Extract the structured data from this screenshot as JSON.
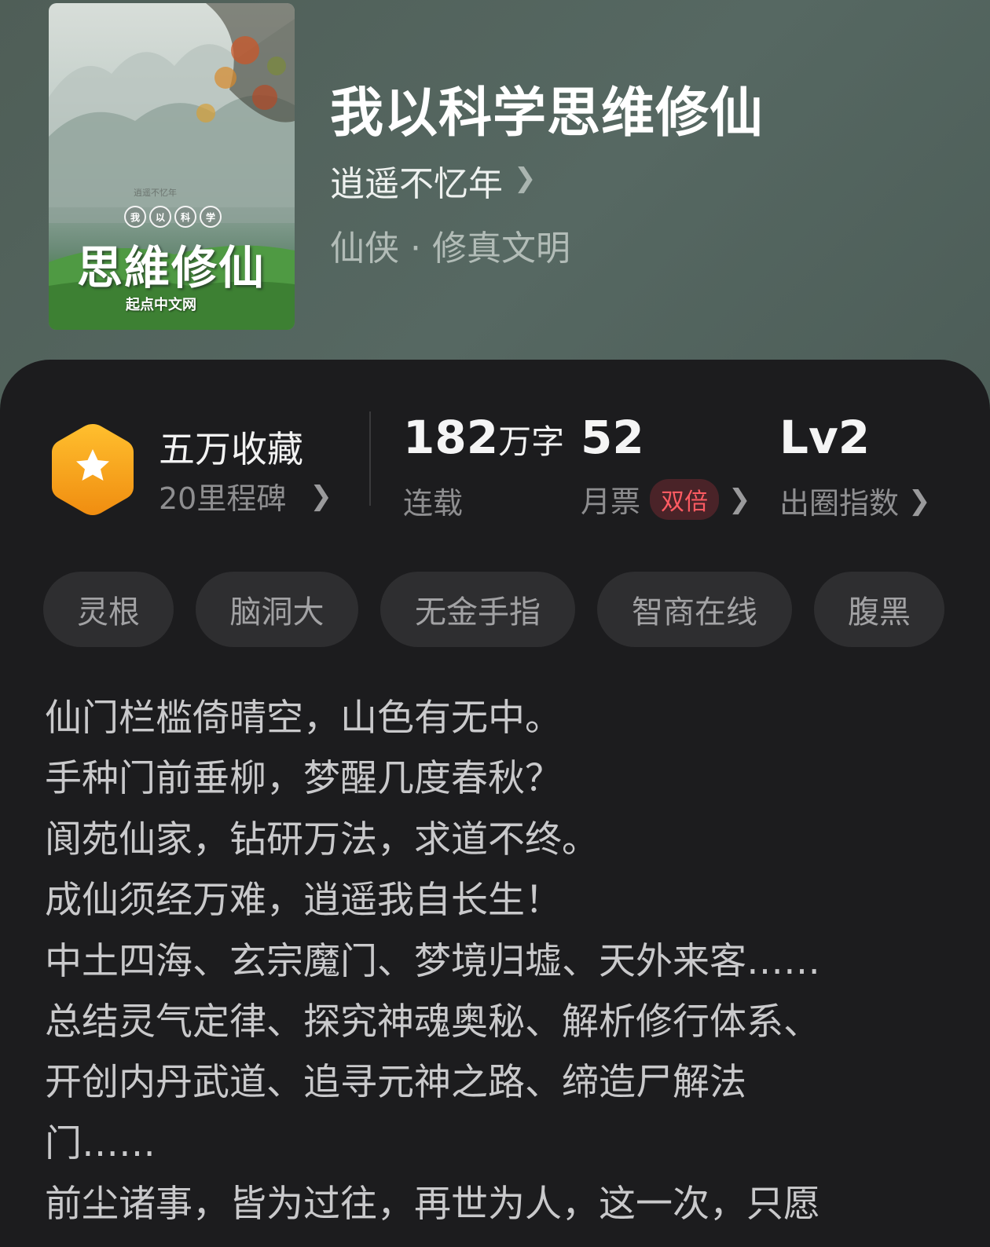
{
  "book": {
    "title": "我以科学思维修仙",
    "author": "逍遥不忆年",
    "genre": "仙侠 · 修真文明"
  },
  "cover": {
    "small_text": "逍遥不忆年",
    "circle_chars": [
      "我",
      "以",
      "科",
      "学"
    ],
    "main_text": "思維修仙",
    "publisher": "起点中文网"
  },
  "stats": {
    "collection_title": "五万收藏",
    "collection_sub": "20里程碑",
    "words_number": "182",
    "words_unit": "万字",
    "status": "连载",
    "monthly_votes": "52",
    "monthly_label": "月票",
    "double_badge": "双倍",
    "circle_level": "Lv2",
    "circle_label": "出圈指数"
  },
  "tags": [
    "灵根",
    "脑洞大",
    "无金手指",
    "智商在线",
    "腹黑"
  ],
  "description": [
    "仙门栏槛倚晴空，山色有无中。",
    "手种门前垂柳，梦醒几度春秋？",
    "阆苑仙家，钻研万法，求道不终。",
    "成仙须经万难，逍遥我自长生！",
    "中土四海、玄宗魔门、梦境归墟、天外来客……",
    "总结灵气定律、探究神魂奥秘、解析修行体系、",
    "开创内丹武道、追寻元神之路、缔造尸解法",
    "门……",
    "前尘诸事，皆为过往，再世为人，这一次，只愿"
  ],
  "colors": {
    "panel_bg": "#1c1c1e",
    "header_bg": "#566862",
    "badge_orange": "#f7a21b",
    "double_red": "#ff5b62"
  },
  "icons": {
    "badge": "star-hexagon-icon",
    "chevron": "chevron-right-icon"
  }
}
